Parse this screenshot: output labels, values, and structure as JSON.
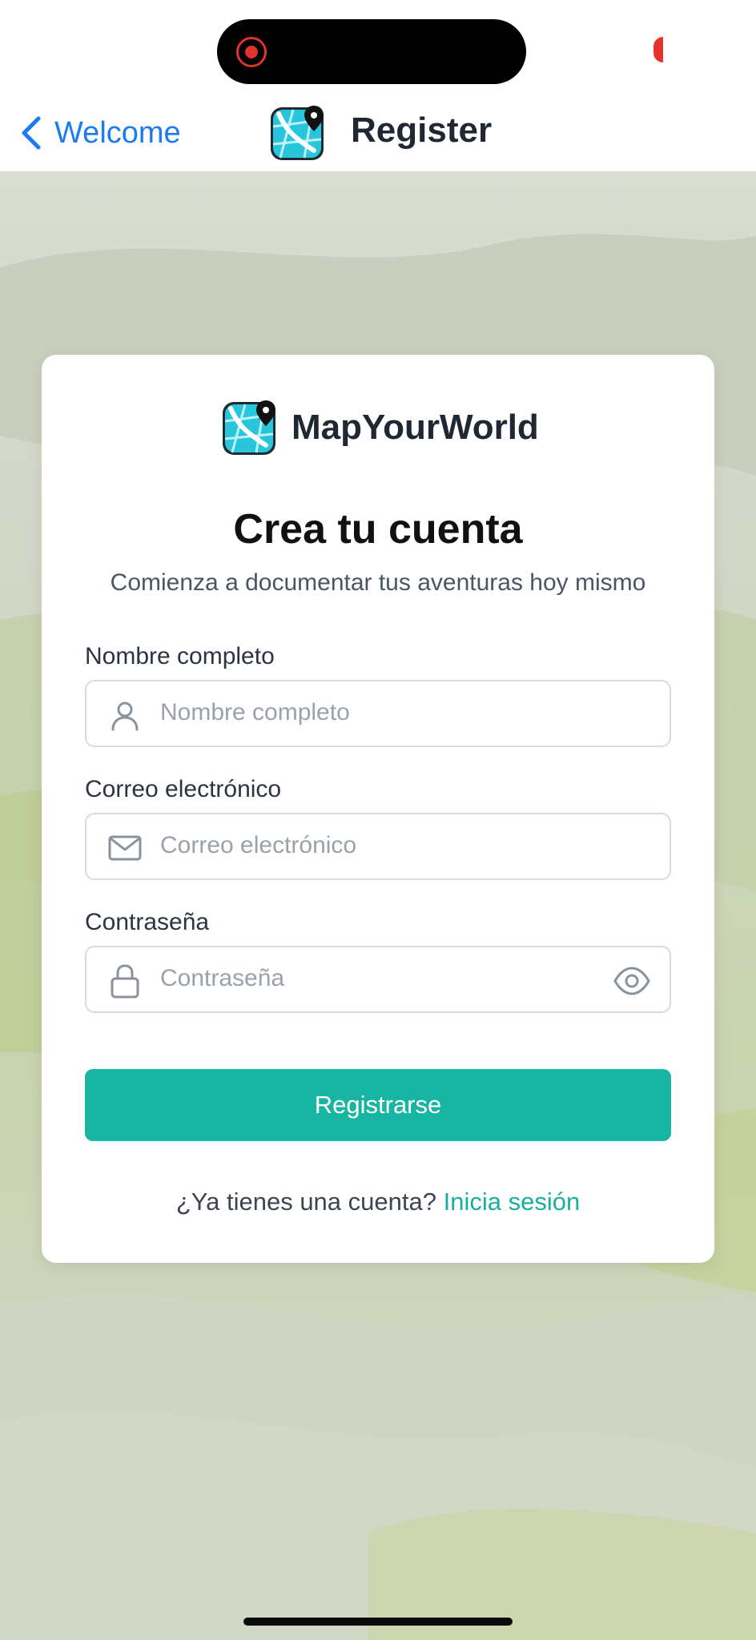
{
  "nav": {
    "back_label": "Welcome",
    "title": "Register",
    "back_icon": "chevron-left-icon",
    "logo_icon": "map-pin-app-logo"
  },
  "card": {
    "brand_name": "MapYourWorld",
    "title": "Crea tu cuenta",
    "subtitle": "Comienza a documentar tus aventuras hoy mismo"
  },
  "form": {
    "name": {
      "label": "Nombre completo",
      "placeholder": "Nombre completo",
      "icon": "user-icon"
    },
    "email": {
      "label": "Correo electrónico",
      "placeholder": "Correo electrónico",
      "icon": "mail-icon"
    },
    "password": {
      "label": "Contraseña",
      "placeholder": "Contraseña",
      "icon": "lock-icon",
      "toggle_icon": "eye-icon"
    },
    "submit_label": "Registrarse"
  },
  "footer": {
    "prompt": "¿Ya tienes una cuenta?",
    "link": "Inicia sesión"
  },
  "colors": {
    "accent": "#17b5a2",
    "link_blue": "#1a7cf0",
    "recording_red": "#e0332b"
  }
}
